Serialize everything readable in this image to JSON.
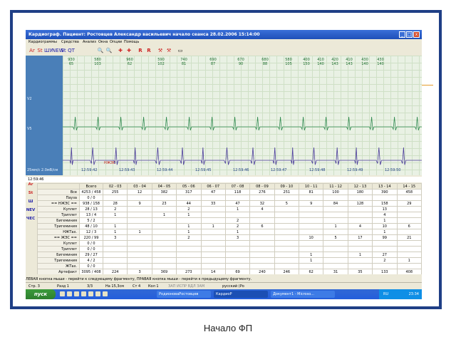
{
  "caption": "Начало ФП",
  "window": {
    "title": "Кардиограф. Пациент: Ростовцев Александр васильевич   начало сеанса 28.02.2006 15:14:00",
    "controls": [
      "_",
      "□",
      "x"
    ]
  },
  "menu": [
    "Кардиограммы",
    "Средства",
    "Анализ",
    "Окна",
    "Опции",
    "Помощь"
  ],
  "toolbar_icons": [
    "Ar",
    "St",
    "ШУ",
    "NEW",
    "St",
    "QT",
    "🔍",
    "🔍",
    "✚",
    "✚",
    "R",
    "R",
    "⚒",
    "⚒",
    "▭"
  ],
  "ecg": {
    "top_numbers": [
      [
        "930",
        "65"
      ],
      [
        "580",
        "103"
      ],
      [
        "960",
        "62"
      ],
      [
        "590",
        "102"
      ],
      [
        "740",
        "81"
      ],
      [
        "690",
        "87"
      ],
      [
        "670",
        "90"
      ],
      [
        "680",
        "88"
      ],
      [
        "580",
        "105"
      ],
      [
        "400",
        "150"
      ],
      [
        "410",
        "140"
      ],
      [
        "420",
        "143"
      ],
      [
        "410",
        "143"
      ],
      [
        "430",
        "140"
      ],
      [
        "430",
        "140"
      ]
    ],
    "leads": [
      "V2",
      "V5"
    ],
    "speed_label": "25мм/с 2.0мВ/см",
    "nzhes_label": "НЖЭС",
    "time_labels": [
      "12:59:42",
      "12:59:43",
      "12:59:44",
      "12:59:45",
      "12:59:46",
      "12:59:47",
      "12:59:48",
      "12:59:49",
      "12:59:50"
    ]
  },
  "time_strip": "12:59:46",
  "side_icons": [
    "Ar",
    "St",
    "Ш",
    "NEV",
    "ЧЕС"
  ],
  "table": {
    "headers": [
      "",
      "Всего",
      "02 - 03",
      "03 - 04",
      "04 - 05",
      "05 - 06",
      "06 - 07",
      "07 - 08",
      "08 - 09",
      "09 - 10",
      "10 - 11",
      "11 - 12",
      "12 - 13",
      "13 - 14",
      "14 - 15"
    ],
    "rows": [
      [
        "Все",
        "4253 / 458",
        "255",
        "12",
        "382",
        "317",
        "47",
        "118",
        "276",
        "251",
        "81",
        "100",
        "180",
        "390",
        "458"
      ],
      [
        "Пауза",
        "0 / 0",
        "",
        "",
        "",
        "",
        "",
        "",
        "",
        "",
        "",
        "",
        "",
        "",
        ""
      ],
      [
        "== НЖЭС ==",
        "938 / 158",
        "28",
        "9",
        "23",
        "44",
        "33",
        "47",
        "32",
        "5",
        "9",
        "84",
        "128",
        "158",
        "29"
      ],
      [
        "Куплет",
        "28 / 13",
        "2",
        "",
        "",
        "2",
        "",
        "1",
        "4",
        "",
        "",
        "",
        "",
        "13",
        ""
      ],
      [
        "Триплет",
        "13 / 4",
        "1",
        "",
        "1",
        "1",
        "",
        "",
        "",
        "",
        "",
        "",
        "",
        "4",
        ""
      ],
      [
        "Бигеминия",
        "5 / 2",
        "",
        "",
        "",
        "",
        "",
        "2",
        "",
        "",
        "",
        "",
        "",
        "1",
        ""
      ],
      [
        "Тригеминия",
        "48 / 10",
        "1",
        "",
        "",
        "1",
        "1",
        "2",
        "6",
        "",
        "",
        "1",
        "4",
        "10",
        "6"
      ],
      [
        "НЖТах.",
        "12 / 3",
        "1",
        "1",
        "",
        "1",
        "",
        "1",
        "",
        "",
        "",
        "",
        "",
        "1",
        ""
      ],
      [
        "== ЖЭС ==",
        "220 / 99",
        "3",
        "",
        "",
        "2",
        "",
        "3",
        "",
        "",
        "10",
        "5",
        "17",
        "99",
        "21"
      ],
      [
        "Куплет",
        "0 / 0",
        "",
        "",
        "",
        "",
        "",
        "",
        "",
        "",
        "",
        "",
        "",
        "",
        ""
      ],
      [
        "Триплет",
        "0 / 0",
        "",
        "",
        "",
        "",
        "",
        "",
        "",
        "",
        "",
        "",
        "",
        "",
        ""
      ],
      [
        "Бигеминия",
        "29 / 27",
        "",
        "",
        "",
        "",
        "",
        "",
        "",
        "",
        "1",
        "",
        "1",
        "27",
        ""
      ],
      [
        "Тригеминия",
        "4 / 2",
        "",
        "",
        "",
        "",
        "",
        "",
        "",
        "",
        "1",
        "",
        "",
        "2",
        "1"
      ],
      [
        "ЖТах.",
        "0 / 0",
        "",
        "",
        "",
        "",
        "",
        "",
        "",
        "",
        "",
        "",
        "",
        "",
        ""
      ],
      [
        "Артефакт",
        "3095 / 408",
        "224",
        "3",
        "369",
        "273",
        "14",
        "69",
        "240",
        "246",
        "62",
        "31",
        "35",
        "133",
        "408"
      ]
    ]
  },
  "hint": "ЛЕВАЯ кнопка мыши - перейти к следующему фрагменту, ПРАВАЯ кнопка мыши - перейти к предыдущему фрагменту.",
  "status": {
    "page": "Стр. 3",
    "section": "Разд 1",
    "pages": "3/3",
    "position": "На 15,3см",
    "line": "Ст 4",
    "col": "Кол 1",
    "flags": "ЗАП  ИСПР  ВДЛ  ЗАМ",
    "lang": "русский (Ро"
  },
  "taskbar": {
    "start": "пуск",
    "tasks": [
      "РодионоваРостовцев",
      "КардиоР",
      "Документ1 - Microso..."
    ],
    "tray_lang": "RU",
    "clock": "23:34"
  },
  "colors": {
    "frame": "#1f3f86",
    "ecg_trace_v2": "#2f8a4f",
    "ecg_trace_v5": "#4a3b9a",
    "marker": "#2aa84a"
  }
}
